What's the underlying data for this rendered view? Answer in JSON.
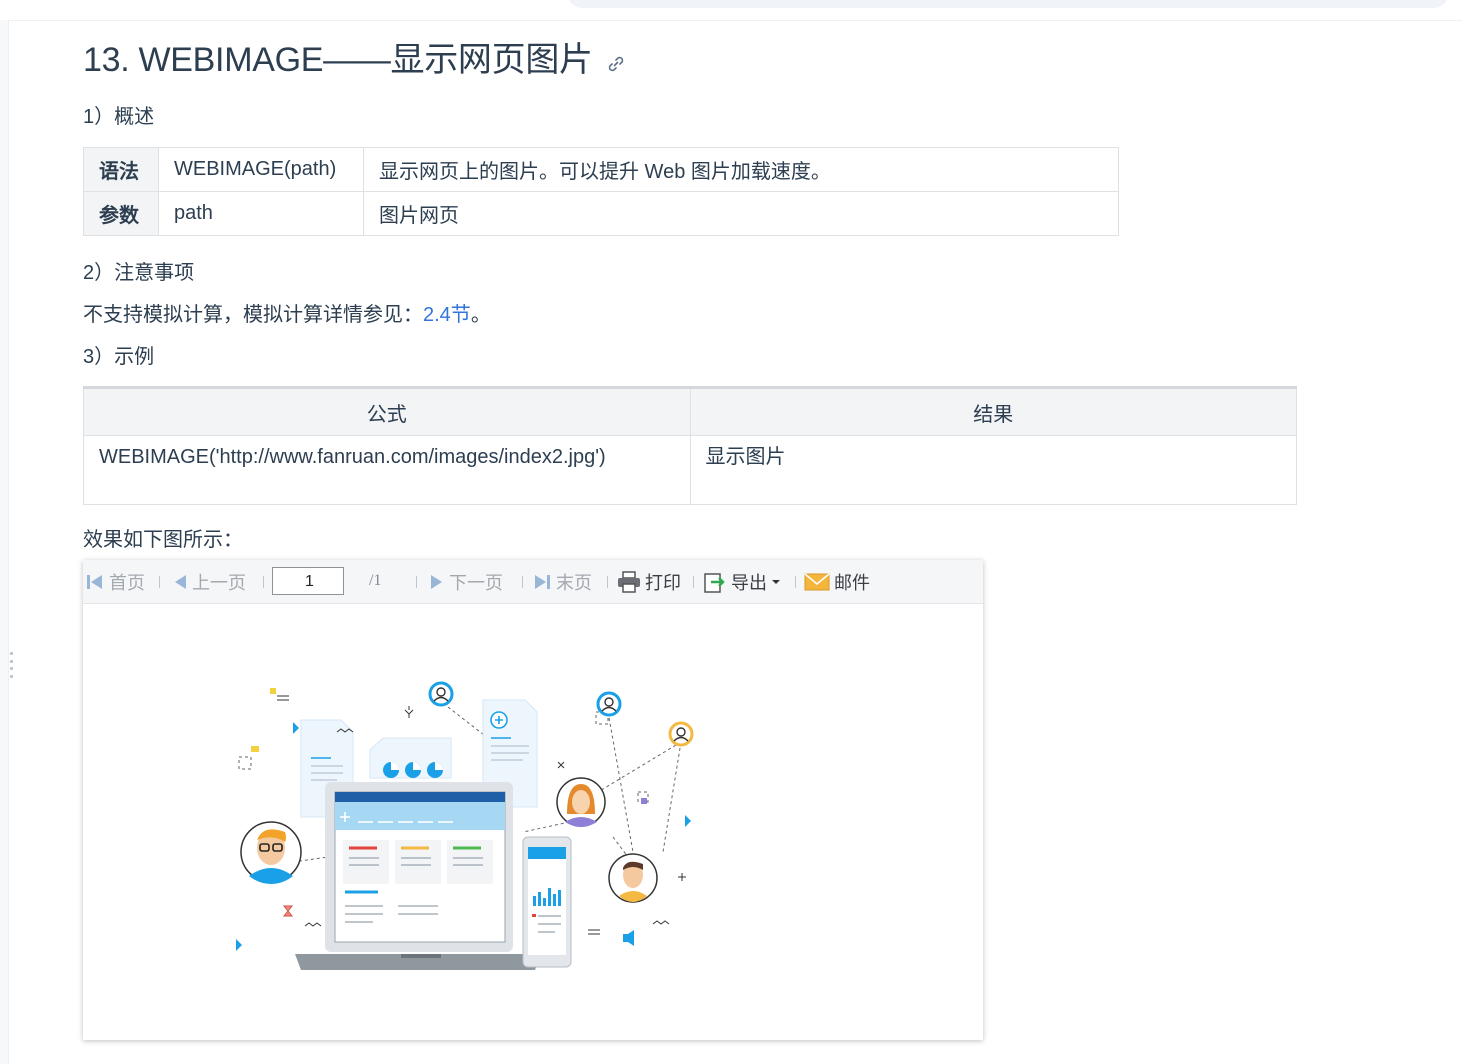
{
  "heading": "13. WEBIMAGE——显示网页图片",
  "section1": "1）概述",
  "syntax_table": [
    {
      "key": "语法",
      "c2": "WEBIMAGE(path)",
      "c3": "显示网页上的图片。可以提升 Web 图片加载速度。"
    },
    {
      "key": "参数",
      "c2": "path",
      "c3": "图片网页"
    }
  ],
  "section2": "2）注意事项",
  "note": {
    "text": "不支持模拟计算，模拟计算详情参见：",
    "link": "2.4节",
    "suffix": "。"
  },
  "section3": "3）示例",
  "example_table": {
    "headers": [
      "公式",
      "结果"
    ],
    "rows": [
      {
        "formula": "WEBIMAGE('http://www.fanruan.com/images/index2.jpg')",
        "result": "显示图片"
      }
    ]
  },
  "effect": "效果如下图所示：",
  "viewer": {
    "first": "首页",
    "prev": "上一页",
    "page": "1",
    "total": "/1",
    "next": "下一页",
    "last": "末页",
    "print": "打印",
    "export": "导出",
    "mail": "邮件"
  },
  "colors": {
    "text": "#2c3e50",
    "link": "#3273dc",
    "accent": "#1aa0e6",
    "border": "#dfe2e5"
  }
}
